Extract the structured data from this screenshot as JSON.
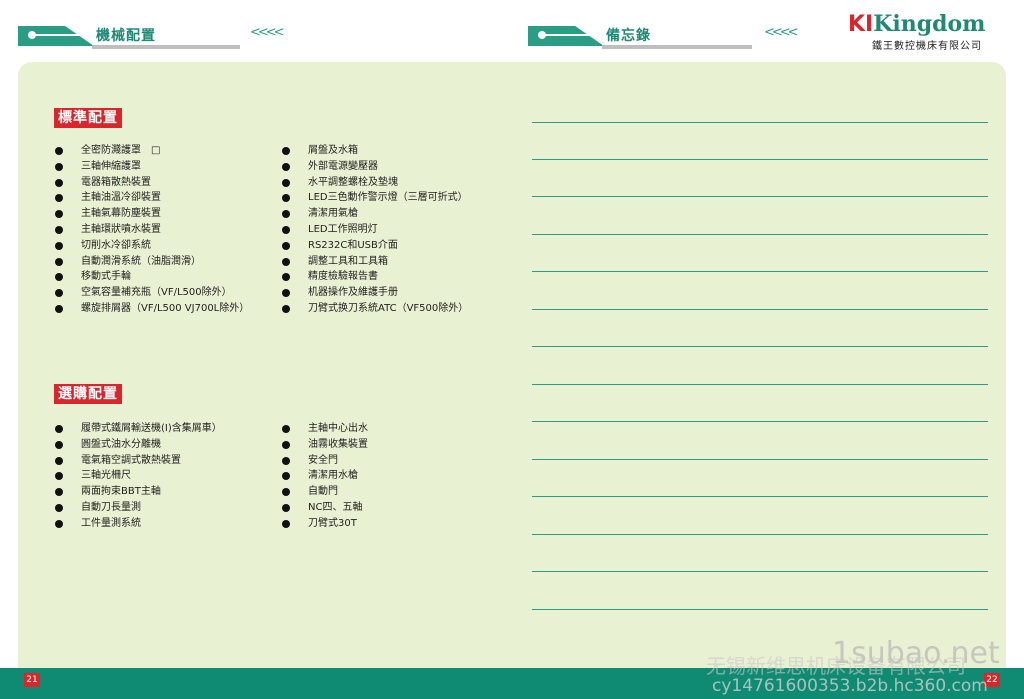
{
  "left_header": {
    "title": "機械配置",
    "chevrons": "<<<<"
  },
  "right_header": {
    "title": "備忘錄",
    "chevrons": "<<<<"
  },
  "logo": {
    "ki": "KI",
    "brand": "Kingdom",
    "company": "鐵王數控機床有限公司"
  },
  "standard": {
    "title": "標準配置",
    "col1": [
      "全密防濺護罩　□",
      "三軸伸縮護罩",
      "電器箱散熱裝置",
      "主軸油溫冷卻裝置",
      "主軸氣幕防塵裝置",
      "主軸環狀噴水裝置",
      "切削水冷卻系統",
      "自動潤滑系統（油脂潤滑）",
      "移動式手輪",
      "空氣容量補充瓶（VF/L500除外）",
      "螺旋排屑器（VF/L500 VJ700L除外）"
    ],
    "col2": [
      "屑盤及水箱",
      "外部電源變壓器",
      "水平調整螺栓及墊塊",
      "LED三色動作警示燈（三層可折式）",
      "清潔用氣槍",
      "LED工作照明灯",
      "RS232C和USB介面",
      "調整工具和工具箱",
      "精度檢驗報告書",
      "机器操作及維護手册",
      "刀臂式换刀系統ATC（VF500除外）"
    ]
  },
  "optional": {
    "title": "選購配置",
    "col1": [
      "履帶式鐵屑輸送機(I)含集屑車）",
      "圓盤式油水分離機",
      "電氣箱空調式散熱裝置",
      "三軸光柵尺",
      "兩面拘束BBT主軸",
      "自動刀長量測",
      "工件量測系統"
    ],
    "col2": [
      "主軸中心出水",
      "油霧收集裝置",
      "安全門",
      "清潔用水槍",
      "自動門",
      "NC四、五軸",
      "刀臂式30T"
    ]
  },
  "footer": {
    "page_left": "21",
    "page_right": "22"
  },
  "watermark": {
    "site": "1subao.net",
    "company": "无锡新维思机床设备有限公司",
    "contact": "cy14761600353.b2b.hc360.com"
  }
}
